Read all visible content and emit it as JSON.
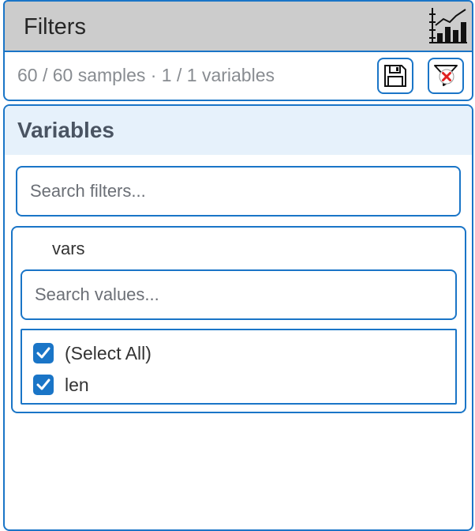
{
  "header": {
    "title": "Filters",
    "chart_icon": "bar-chart-icon"
  },
  "summary": {
    "text": "60 / 60 samples · 1 / 1 variables",
    "save_icon": "save-icon",
    "clear_icon": "clear-filter-icon"
  },
  "variables_panel": {
    "title": "Variables",
    "search": {
      "placeholder": "Search filters...",
      "value": ""
    },
    "filter_card": {
      "label": "vars",
      "search": {
        "placeholder": "Search values...",
        "value": ""
      },
      "options": [
        {
          "label": "(Select All)",
          "checked": true
        },
        {
          "label": "len",
          "checked": true
        }
      ]
    }
  },
  "colors": {
    "accent": "#1a75c7",
    "header_bg": "#cccccc",
    "panel_header_bg": "#e6f1fb",
    "clear_red": "#e02020"
  }
}
